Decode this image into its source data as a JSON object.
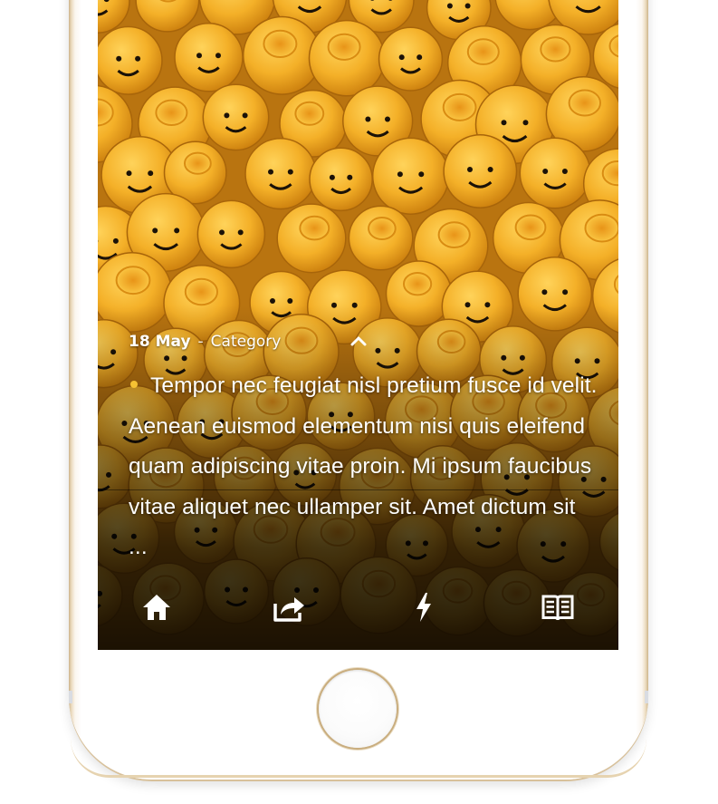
{
  "post": {
    "date": "18 May",
    "separator": "-",
    "category": "Category",
    "excerpt": "Tempor nec feugiat nisl pretium fusce id velit. Aenean euismod elementum nisi quis eleifend quam adipiscing vitae proin. Mi ipsum faucibus vitae aliquet nec ullamper sit. Amet dictum sit ..."
  },
  "tabbar": {
    "items": [
      {
        "icon": "home-icon"
      },
      {
        "icon": "share-icon"
      },
      {
        "icon": "lightning-icon"
      },
      {
        "icon": "book-icon"
      }
    ]
  },
  "colors": {
    "bullet": "#f6c233",
    "text": "#ffffff",
    "phone_trim": "#cdb48a"
  }
}
